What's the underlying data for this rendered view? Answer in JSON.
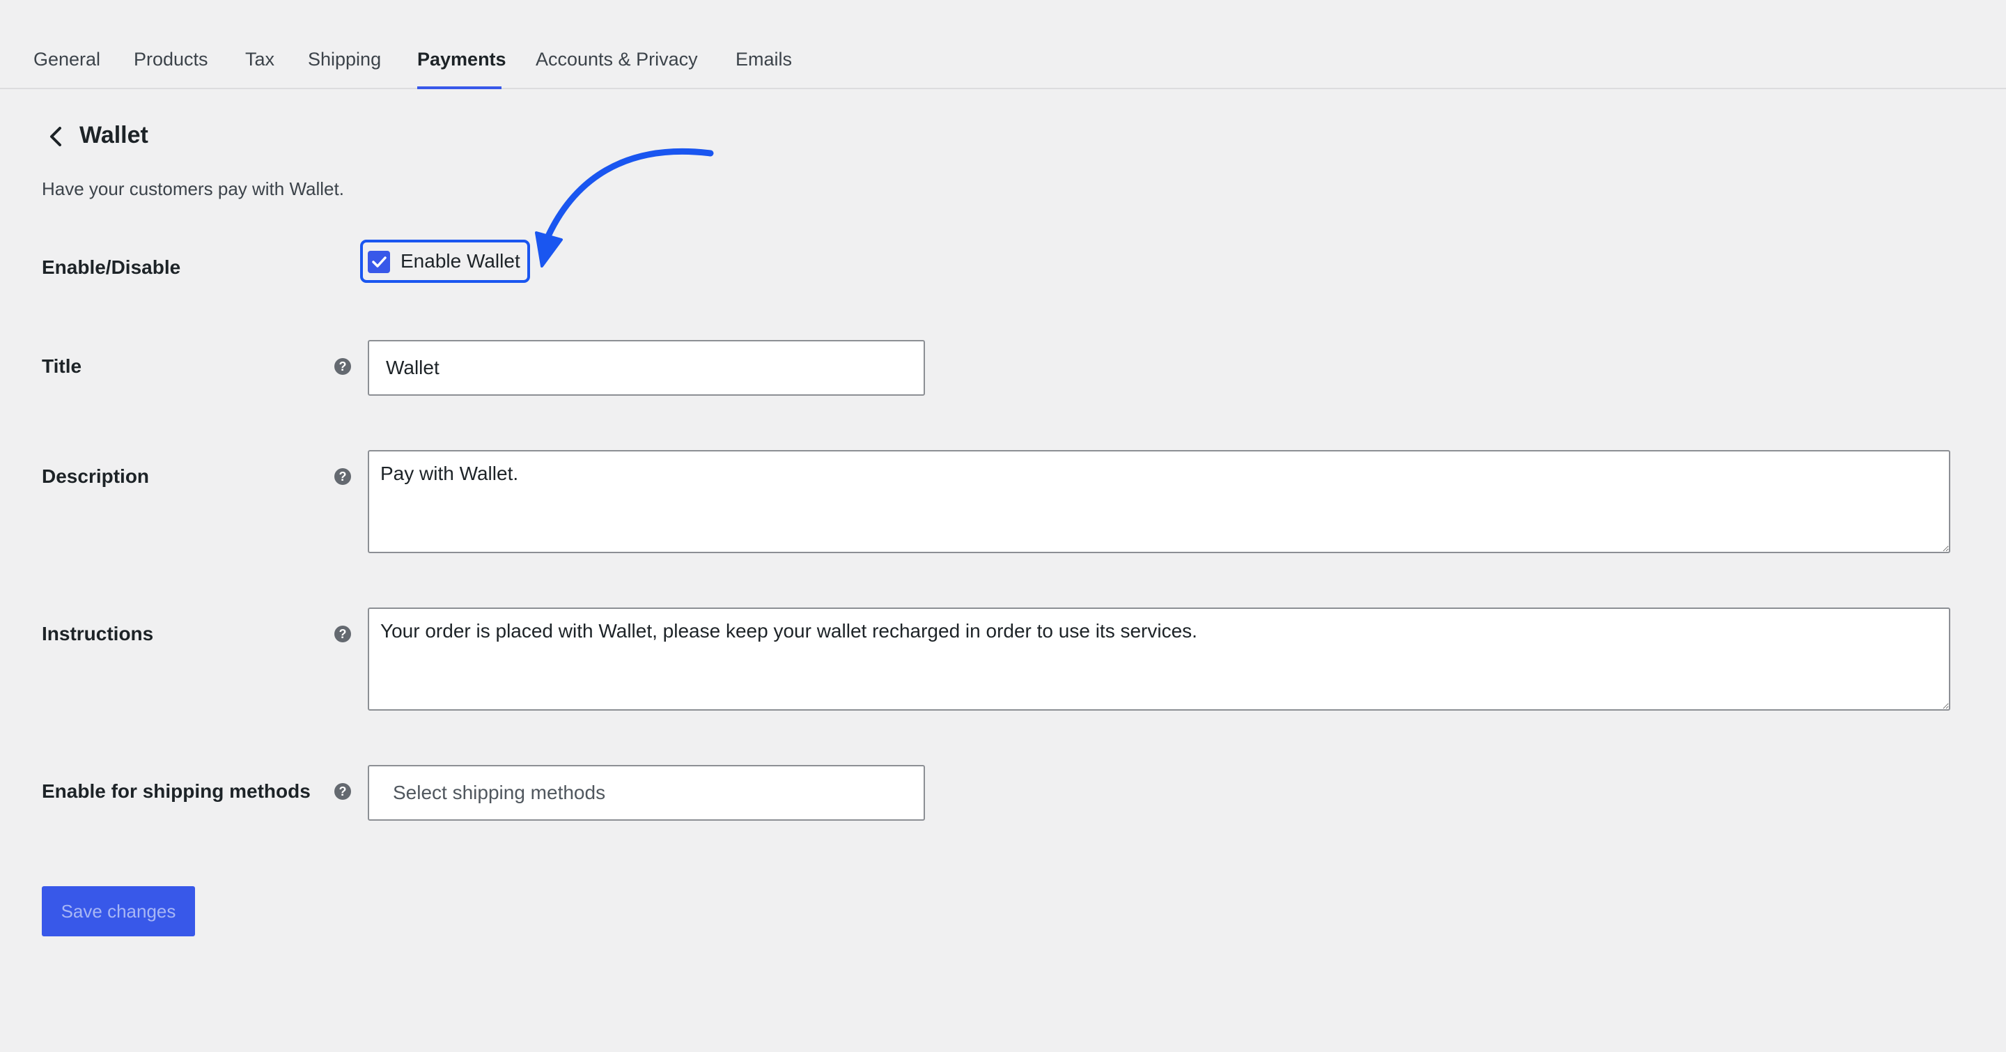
{
  "tabs": [
    {
      "label": "General",
      "active": false
    },
    {
      "label": "Products",
      "active": false
    },
    {
      "label": "Tax",
      "active": false
    },
    {
      "label": "Shipping",
      "active": false
    },
    {
      "label": "Payments",
      "active": true
    },
    {
      "label": "Accounts & Privacy",
      "active": false
    },
    {
      "label": "Emails",
      "active": false
    }
  ],
  "header": {
    "back_icon": "chevron-left-icon",
    "title": "Wallet",
    "description": "Have your customers pay with Wallet."
  },
  "form": {
    "enable": {
      "label": "Enable/Disable",
      "checkbox_label": "Enable Wallet",
      "checked": true
    },
    "title": {
      "label": "Title",
      "value": "Wallet",
      "help_icon": "help-icon"
    },
    "description": {
      "label": "Description",
      "value": "Pay with Wallet.",
      "help_icon": "help-icon"
    },
    "instructions": {
      "label": "Instructions",
      "value": "Your order is placed with Wallet, please keep your wallet recharged in order to use its services.",
      "help_icon": "help-icon"
    },
    "shipping_methods": {
      "label": "Enable for shipping methods",
      "placeholder": "Select shipping methods",
      "help_icon": "help-icon"
    }
  },
  "actions": {
    "save_label": "Save changes"
  },
  "colors": {
    "accent": "#3858e9",
    "annotation": "#1a56f0",
    "background": "#f0f0f1"
  }
}
